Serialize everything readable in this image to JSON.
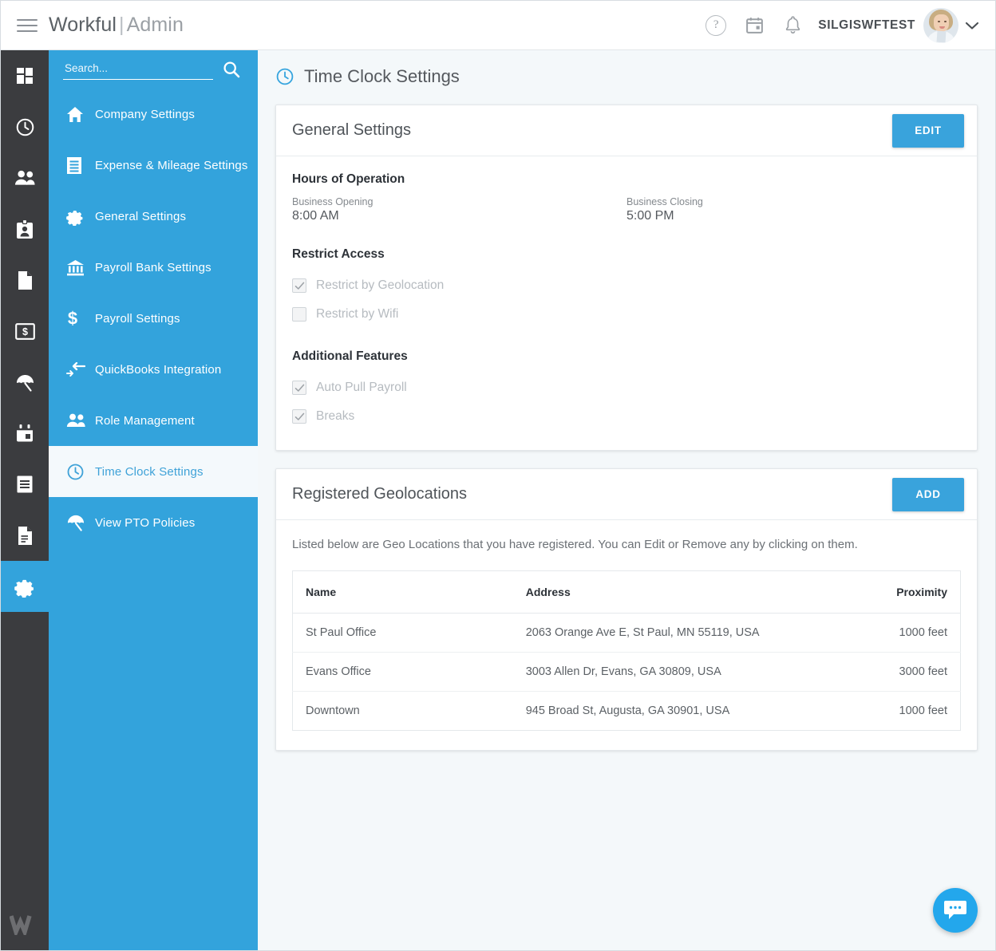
{
  "header": {
    "brand_name": "Workful",
    "brand_separator": "|",
    "brand_sub": "Admin",
    "username": "SILGISWFTEST",
    "help_glyph": "?"
  },
  "search": {
    "placeholder": "Search...",
    "value": ""
  },
  "rail": {
    "items": [
      {
        "icon": "dashboard-grid-icon",
        "active": false
      },
      {
        "icon": "clock-icon",
        "active": false
      },
      {
        "icon": "people-icon",
        "active": false
      },
      {
        "icon": "id-badge-icon",
        "active": false
      },
      {
        "icon": "document-icon",
        "active": false
      },
      {
        "icon": "money-icon",
        "active": false
      },
      {
        "icon": "umbrella-icon",
        "active": false
      },
      {
        "icon": "calendar-icon",
        "active": false
      },
      {
        "icon": "list-icon",
        "active": false
      },
      {
        "icon": "file-text-icon",
        "active": false
      },
      {
        "icon": "gear-icon",
        "active": true
      }
    ],
    "logo_letter": "W"
  },
  "sidebar": {
    "items": [
      {
        "label": "Company Settings",
        "icon": "home-icon",
        "active": false
      },
      {
        "label": "Expense & Mileage Settings",
        "icon": "receipt-icon",
        "active": false
      },
      {
        "label": "General Settings",
        "icon": "gear-icon",
        "active": false
      },
      {
        "label": "Payroll Bank Settings",
        "icon": "bank-icon",
        "active": false
      },
      {
        "label": "Payroll Settings",
        "icon": "dollar-icon",
        "active": false
      },
      {
        "label": "QuickBooks Integration",
        "icon": "import-arrow-icon",
        "active": false
      },
      {
        "label": "Role Management",
        "icon": "people-icon",
        "active": false
      },
      {
        "label": "Time Clock Settings",
        "icon": "clock-icon",
        "active": true
      },
      {
        "label": "View PTO Policies",
        "icon": "umbrella-icon",
        "active": false
      }
    ]
  },
  "page": {
    "title": "Time Clock Settings",
    "title_icon": "clock-icon"
  },
  "general_settings": {
    "title": "General Settings",
    "edit_label": "EDIT",
    "hours_heading": "Hours of Operation",
    "opening_label": "Business Opening",
    "opening_value": "8:00 AM",
    "closing_label": "Business Closing",
    "closing_value": "5:00 PM",
    "restrict_heading": "Restrict Access",
    "restrict_options": [
      {
        "label": "Restrict by Geolocation",
        "checked": true
      },
      {
        "label": "Restrict by Wifi",
        "checked": false
      }
    ],
    "features_heading": "Additional Features",
    "feature_options": [
      {
        "label": "Auto Pull Payroll",
        "checked": true
      },
      {
        "label": "Breaks",
        "checked": true
      }
    ]
  },
  "geolocations": {
    "title": "Registered Geolocations",
    "add_label": "ADD",
    "description": "Listed below are Geo Locations that you have registered. You can Edit or Remove any by clicking on them.",
    "columns": [
      "Name",
      "Address",
      "Proximity"
    ],
    "rows": [
      {
        "name": "St Paul Office",
        "address": "2063 Orange Ave E, St Paul, MN 55119, USA",
        "proximity": "1000 feet"
      },
      {
        "name": "Evans Office",
        "address": "3003 Allen Dr, Evans, GA 30809, USA",
        "proximity": "3000 feet"
      },
      {
        "name": "Downtown",
        "address": "945 Broad St, Augusta, GA 30901, USA",
        "proximity": "1000 feet"
      }
    ]
  },
  "chat": {
    "icon": "chat-bubble-icon"
  },
  "colors": {
    "accent_blue": "#33a3dc",
    "rail_dark": "#3b3c3f",
    "page_bg": "#f4f8fa",
    "chat_blue": "#23a7ec"
  }
}
